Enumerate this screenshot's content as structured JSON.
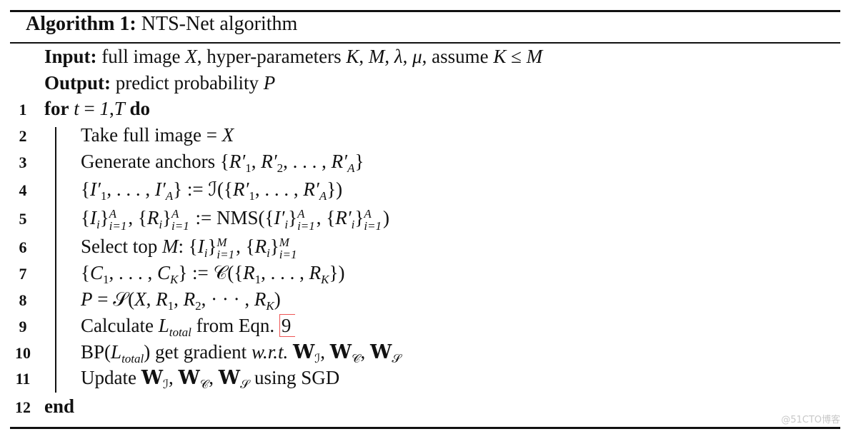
{
  "algorithm": {
    "label": "Algorithm 1:",
    "title": "NTS-Net algorithm",
    "header_lines": [
      [
        {
          "t": "Input:",
          "s": "b"
        },
        {
          "t": " full image "
        },
        {
          "t": "X",
          "s": "i"
        },
        {
          "t": ", hyper-parameters "
        },
        {
          "t": "K",
          "s": "i"
        },
        {
          "t": ", "
        },
        {
          "t": "M",
          "s": "i"
        },
        {
          "t": ", "
        },
        {
          "t": "λ",
          "s": "i"
        },
        {
          "t": ", "
        },
        {
          "t": "μ",
          "s": "i"
        },
        {
          "t": ", assume "
        },
        {
          "t": "K",
          "s": "i"
        },
        {
          "t": " ≤ "
        },
        {
          "t": "M",
          "s": "i"
        }
      ],
      [
        {
          "t": "Output:",
          "s": "b"
        },
        {
          "t": " predict probability "
        },
        {
          "t": "P",
          "s": "i"
        }
      ]
    ],
    "steps": [
      {
        "num": "1",
        "indent": false,
        "seg": [
          {
            "t": "for",
            "s": "b"
          },
          {
            "t": " "
          },
          {
            "t": "t",
            "s": "i"
          },
          {
            "t": " = "
          },
          {
            "t": "1",
            "s": "i"
          },
          {
            "t": ","
          },
          {
            "t": "T",
            "s": "i"
          },
          {
            "t": " "
          },
          {
            "t": "do",
            "s": "b"
          }
        ]
      },
      {
        "num": "2",
        "indent": true,
        "seg": [
          {
            "t": "Take full image = "
          },
          {
            "t": "X",
            "s": "i"
          }
        ]
      },
      {
        "num": "3",
        "indent": true,
        "seg": [
          {
            "t": "Generate anchors {"
          },
          {
            "t": "R′",
            "s": "i"
          },
          {
            "t": "1",
            "s": "sub"
          },
          {
            "t": ", "
          },
          {
            "t": "R′",
            "s": "i"
          },
          {
            "t": "2",
            "s": "sub"
          },
          {
            "t": ", . . . , "
          },
          {
            "t": "R′",
            "s": "i"
          },
          {
            "t": "A",
            "s": "subi"
          },
          {
            "t": "}"
          }
        ]
      },
      {
        "num": "4",
        "indent": true,
        "seg": [
          {
            "t": "{"
          },
          {
            "t": "I′",
            "s": "i"
          },
          {
            "t": "1",
            "s": "sub"
          },
          {
            "t": ", . . . , "
          },
          {
            "t": "I′",
            "s": "i"
          },
          {
            "t": "A",
            "s": "subi"
          },
          {
            "t": "} := ℐ({"
          },
          {
            "t": "R′",
            "s": "i"
          },
          {
            "t": "1",
            "s": "sub"
          },
          {
            "t": ", . . . , "
          },
          {
            "t": "R′",
            "s": "i"
          },
          {
            "t": "A",
            "s": "subi"
          },
          {
            "t": "})"
          }
        ]
      },
      {
        "num": "5",
        "indent": true,
        "seg": [
          {
            "t": "{"
          },
          {
            "t": "I",
            "s": "i"
          },
          {
            "t": "i",
            "s": "subi"
          },
          {
            "t": "}"
          },
          {
            "s": "ss",
            "sup": "A",
            "sub": "i=1"
          },
          {
            "t": ", {"
          },
          {
            "t": "R",
            "s": "i"
          },
          {
            "t": "i",
            "s": "subi"
          },
          {
            "t": "}"
          },
          {
            "s": "ss",
            "sup": "A",
            "sub": "i=1"
          },
          {
            "t": " := NMS({"
          },
          {
            "t": "I′",
            "s": "i"
          },
          {
            "t": "i",
            "s": "subi"
          },
          {
            "t": "}"
          },
          {
            "s": "ss",
            "sup": "A",
            "sub": "i=1"
          },
          {
            "t": ", {"
          },
          {
            "t": "R′",
            "s": "i"
          },
          {
            "t": "i",
            "s": "subi"
          },
          {
            "t": "}"
          },
          {
            "s": "ss",
            "sup": "A",
            "sub": "i=1"
          },
          {
            "t": ")"
          }
        ]
      },
      {
        "num": "6",
        "indent": true,
        "seg": [
          {
            "t": "Select top "
          },
          {
            "t": "M",
            "s": "i"
          },
          {
            "t": ": {"
          },
          {
            "t": "I",
            "s": "i"
          },
          {
            "t": "i",
            "s": "subi"
          },
          {
            "t": "}"
          },
          {
            "s": "ss",
            "sup": "M",
            "sub": "i=1"
          },
          {
            "t": ", {"
          },
          {
            "t": "R",
            "s": "i"
          },
          {
            "t": "i",
            "s": "subi"
          },
          {
            "t": "}"
          },
          {
            "s": "ss",
            "sup": "M",
            "sub": "i=1"
          }
        ]
      },
      {
        "num": "7",
        "indent": true,
        "seg": [
          {
            "t": "{"
          },
          {
            "t": "C",
            "s": "i"
          },
          {
            "t": "1",
            "s": "sub"
          },
          {
            "t": ", . . . , "
          },
          {
            "t": "C",
            "s": "i"
          },
          {
            "t": "K",
            "s": "subi"
          },
          {
            "t": "} := 𝒞({"
          },
          {
            "t": "R",
            "s": "i"
          },
          {
            "t": "1",
            "s": "sub"
          },
          {
            "t": ", . . . , "
          },
          {
            "t": "R",
            "s": "i"
          },
          {
            "t": "K",
            "s": "subi"
          },
          {
            "t": "})"
          }
        ]
      },
      {
        "num": "8",
        "indent": true,
        "seg": [
          {
            "t": "P",
            "s": "i"
          },
          {
            "t": " = 𝒮("
          },
          {
            "t": "X",
            "s": "i"
          },
          {
            "t": ", "
          },
          {
            "t": "R",
            "s": "i"
          },
          {
            "t": "1",
            "s": "sub"
          },
          {
            "t": ", "
          },
          {
            "t": "R",
            "s": "i"
          },
          {
            "t": "2",
            "s": "sub"
          },
          {
            "t": ", · · · , "
          },
          {
            "t": "R",
            "s": "i"
          },
          {
            "t": "K",
            "s": "subi"
          },
          {
            "t": ")"
          }
        ]
      },
      {
        "num": "9",
        "indent": true,
        "seg": [
          {
            "t": "Calculate "
          },
          {
            "t": "L",
            "s": "i"
          },
          {
            "t": "total",
            "s": "subi"
          },
          {
            "t": " from Eqn. "
          },
          {
            "t": "9",
            "s": "ref"
          }
        ]
      },
      {
        "num": "10",
        "indent": true,
        "seg": [
          {
            "t": "BP("
          },
          {
            "t": "L",
            "s": "i"
          },
          {
            "t": "total",
            "s": "subi"
          },
          {
            "t": ") get gradient "
          },
          {
            "t": "w.r.t.",
            "s": "i"
          },
          {
            "t": " "
          },
          {
            "t": "W",
            "s": "bb"
          },
          {
            "t": "ℐ",
            "s": "sub"
          },
          {
            "t": ", "
          },
          {
            "t": "W",
            "s": "bb"
          },
          {
            "t": "𝒞",
            "s": "sub"
          },
          {
            "t": ", "
          },
          {
            "t": "W",
            "s": "bb"
          },
          {
            "t": "𝒮",
            "s": "sub"
          }
        ]
      },
      {
        "num": "11",
        "indent": true,
        "seg": [
          {
            "t": "Update "
          },
          {
            "t": "W",
            "s": "bb"
          },
          {
            "t": "ℐ",
            "s": "sub"
          },
          {
            "t": ", "
          },
          {
            "t": "W",
            "s": "bb"
          },
          {
            "t": "𝒞",
            "s": "sub"
          },
          {
            "t": ", "
          },
          {
            "t": "W",
            "s": "bb"
          },
          {
            "t": "𝒮",
            "s": "sub"
          },
          {
            "t": " using SGD"
          }
        ]
      },
      {
        "num": "12",
        "indent": false,
        "seg": [
          {
            "t": "end",
            "s": "b"
          }
        ]
      }
    ]
  },
  "watermark": "@51CTO博客"
}
